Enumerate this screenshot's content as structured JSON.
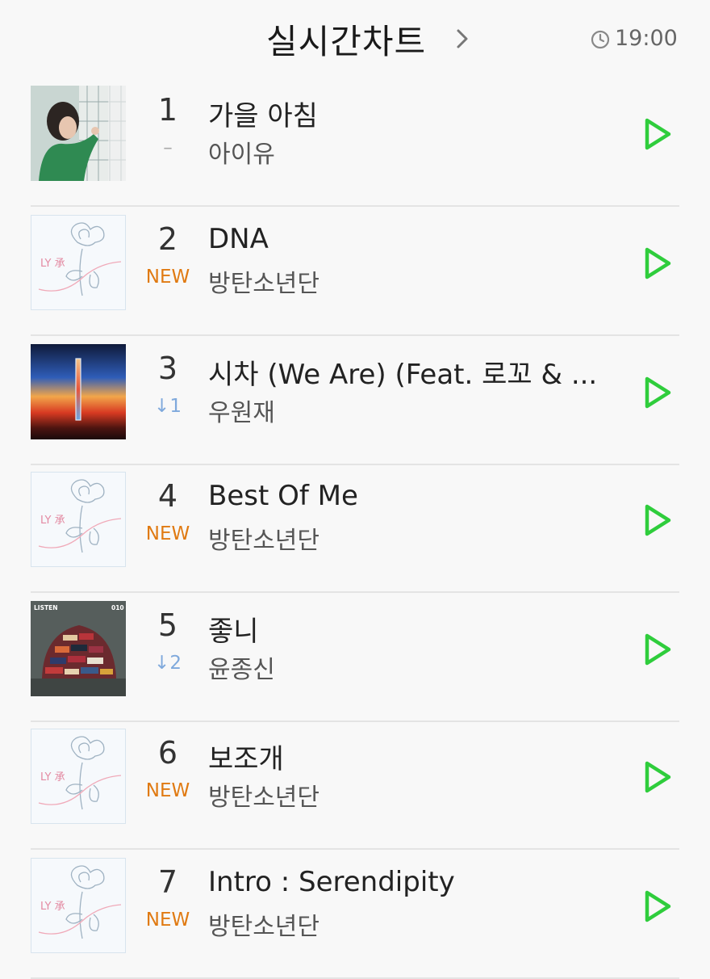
{
  "header": {
    "title": "실시간차트",
    "time": "19:00"
  },
  "colors": {
    "play_accent": "#2fcd3c",
    "new_badge": "#e07a12",
    "down_indicator": "#7fa9dc"
  },
  "chart": [
    {
      "rank": "1",
      "change": "–",
      "change_type": "same",
      "title": "가을 아침",
      "artist": "아이유",
      "cover": "iu-cover"
    },
    {
      "rank": "2",
      "change": "NEW",
      "change_type": "new",
      "title": "DNA",
      "artist": "방탄소년단",
      "cover": "bts-flower-cover"
    },
    {
      "rank": "3",
      "change": "↓1",
      "change_type": "down",
      "title": "시차 (We Are) (Feat. 로꼬 & ...",
      "artist": "우원재",
      "cover": "sunset-cover"
    },
    {
      "rank": "4",
      "change": "NEW",
      "change_type": "new",
      "title": "Best Of Me",
      "artist": "방탄소년단",
      "cover": "bts-flower-cover"
    },
    {
      "rank": "5",
      "change": "↓2",
      "change_type": "down",
      "title": "좋니",
      "artist": "윤종신",
      "cover": "listen-cover"
    },
    {
      "rank": "6",
      "change": "NEW",
      "change_type": "new",
      "title": "보조개",
      "artist": "방탄소년단",
      "cover": "bts-flower-cover"
    },
    {
      "rank": "7",
      "change": "NEW",
      "change_type": "new",
      "title": "Intro : Serendipity",
      "artist": "방탄소년단",
      "cover": "bts-flower-cover"
    }
  ],
  "covers": {
    "listen_text": "LISTEN",
    "listen_number": "010",
    "bts_text": "LY 承"
  }
}
